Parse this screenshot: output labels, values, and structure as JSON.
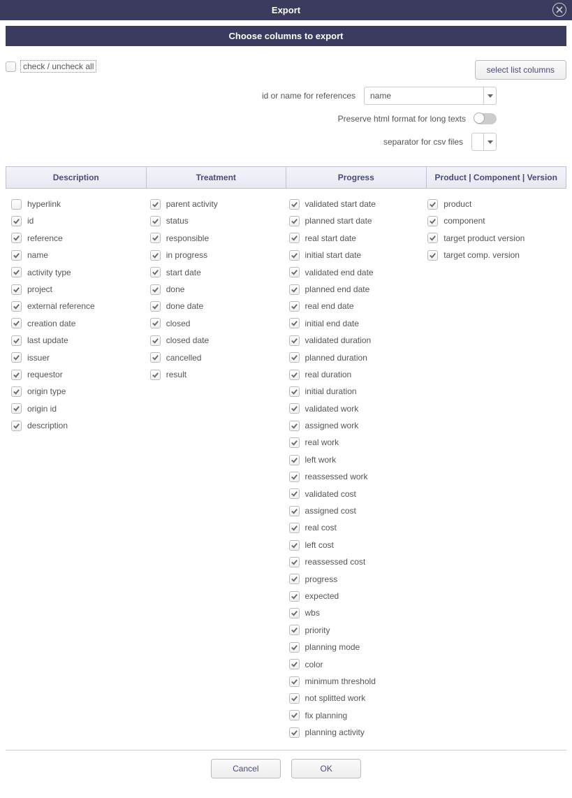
{
  "title": "Export",
  "subtitle": "Choose columns to export",
  "checkAllLabel": "check / uncheck all",
  "checkAllChecked": false,
  "selectListColumnsLabel": "select list columns",
  "options": {
    "referencesLabel": "id or name for references",
    "referencesValue": "name",
    "preserveHtmlLabel": "Preserve html format for long texts",
    "preserveHtmlOn": false,
    "separatorLabel": "separator for csv files",
    "separatorValue": ";"
  },
  "columnGroups": [
    {
      "title": "Description",
      "items": [
        {
          "label": "hyperlink",
          "checked": false
        },
        {
          "label": "id",
          "checked": true
        },
        {
          "label": "reference",
          "checked": true
        },
        {
          "label": "name",
          "checked": true
        },
        {
          "label": "activity type",
          "checked": true
        },
        {
          "label": "project",
          "checked": true
        },
        {
          "label": "external reference",
          "checked": true
        },
        {
          "label": "creation date",
          "checked": true
        },
        {
          "label": "last update",
          "checked": true
        },
        {
          "label": "issuer",
          "checked": true
        },
        {
          "label": "requestor",
          "checked": true
        },
        {
          "label": "origin type",
          "checked": true
        },
        {
          "label": "origin id",
          "checked": true
        },
        {
          "label": "description",
          "checked": true
        }
      ]
    },
    {
      "title": "Treatment",
      "items": [
        {
          "label": "parent activity",
          "checked": true
        },
        {
          "label": "status",
          "checked": true
        },
        {
          "label": "responsible",
          "checked": true
        },
        {
          "label": "in progress",
          "checked": true
        },
        {
          "label": "start date",
          "checked": true
        },
        {
          "label": "done",
          "checked": true
        },
        {
          "label": "done date",
          "checked": true
        },
        {
          "label": "closed",
          "checked": true
        },
        {
          "label": "closed date",
          "checked": true
        },
        {
          "label": "cancelled",
          "checked": true
        },
        {
          "label": "result",
          "checked": true
        }
      ]
    },
    {
      "title": "Progress",
      "items": [
        {
          "label": "validated start date",
          "checked": true
        },
        {
          "label": "planned start date",
          "checked": true
        },
        {
          "label": "real start date",
          "checked": true
        },
        {
          "label": "initial start date",
          "checked": true
        },
        {
          "label": "validated end date",
          "checked": true
        },
        {
          "label": "planned end date",
          "checked": true
        },
        {
          "label": "real end date",
          "checked": true
        },
        {
          "label": "initial end date",
          "checked": true
        },
        {
          "label": "validated duration",
          "checked": true
        },
        {
          "label": "planned duration",
          "checked": true
        },
        {
          "label": "real duration",
          "checked": true
        },
        {
          "label": "initial duration",
          "checked": true
        },
        {
          "label": "validated work",
          "checked": true
        },
        {
          "label": "assigned work",
          "checked": true
        },
        {
          "label": "real work",
          "checked": true
        },
        {
          "label": "left work",
          "checked": true
        },
        {
          "label": "reassessed work",
          "checked": true
        },
        {
          "label": "validated cost",
          "checked": true
        },
        {
          "label": "assigned cost",
          "checked": true
        },
        {
          "label": "real cost",
          "checked": true
        },
        {
          "label": "left cost",
          "checked": true
        },
        {
          "label": "reassessed cost",
          "checked": true
        },
        {
          "label": "progress",
          "checked": true
        },
        {
          "label": "expected",
          "checked": true
        },
        {
          "label": "wbs",
          "checked": true
        },
        {
          "label": "priority",
          "checked": true
        },
        {
          "label": "planning mode",
          "checked": true
        },
        {
          "label": "color",
          "checked": true
        },
        {
          "label": "minimum threshold",
          "checked": true
        },
        {
          "label": "not splitted work",
          "checked": true
        },
        {
          "label": "fix planning",
          "checked": true
        },
        {
          "label": "planning activity",
          "checked": true
        }
      ]
    },
    {
      "title": "Product | Component | Version",
      "items": [
        {
          "label": "product",
          "checked": true
        },
        {
          "label": "component",
          "checked": true
        },
        {
          "label": "target product version",
          "checked": true
        },
        {
          "label": "target comp. version",
          "checked": true
        }
      ]
    }
  ],
  "buttons": {
    "cancel": "Cancel",
    "ok": "OK"
  }
}
